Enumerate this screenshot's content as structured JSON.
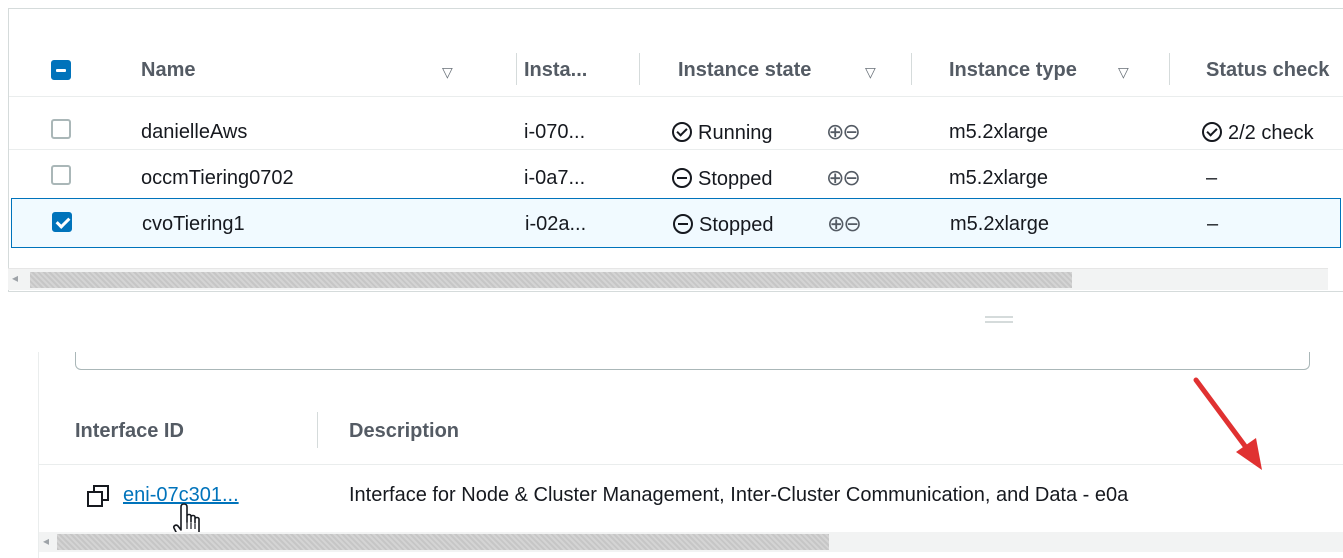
{
  "instances_table": {
    "columns": [
      {
        "label": "Name"
      },
      {
        "label": "Insta..."
      },
      {
        "label": "Instance state"
      },
      {
        "label": "Instance type"
      },
      {
        "label": "Status check"
      }
    ],
    "rows": [
      {
        "name": "danielleAws",
        "instance_id": "i-070...",
        "state": "Running",
        "type": "m5.2xlarge",
        "status_check": "2/2 check",
        "selected": false
      },
      {
        "name": "occmTiering0702",
        "instance_id": "i-0a7...",
        "state": "Stopped",
        "type": "m5.2xlarge",
        "status_check": "–",
        "selected": false
      },
      {
        "name": "cvoTiering1",
        "instance_id": "i-02a...",
        "state": "Stopped",
        "type": "m5.2xlarge",
        "status_check": "–",
        "selected": true
      }
    ]
  },
  "network_interfaces": {
    "columns": [
      {
        "label": "Interface ID"
      },
      {
        "label": "Description"
      }
    ],
    "rows": [
      {
        "interface_id": "eni-07c301...",
        "description": "Interface for Node & Cluster Management, Inter-Cluster Communication, and Data - e0a"
      }
    ]
  },
  "colors": {
    "link": "#0073bb",
    "running": "#1d8102",
    "stopped": "#d13212",
    "selected_row_border": "#0073bb",
    "annotation_arrow": "#e03131"
  }
}
